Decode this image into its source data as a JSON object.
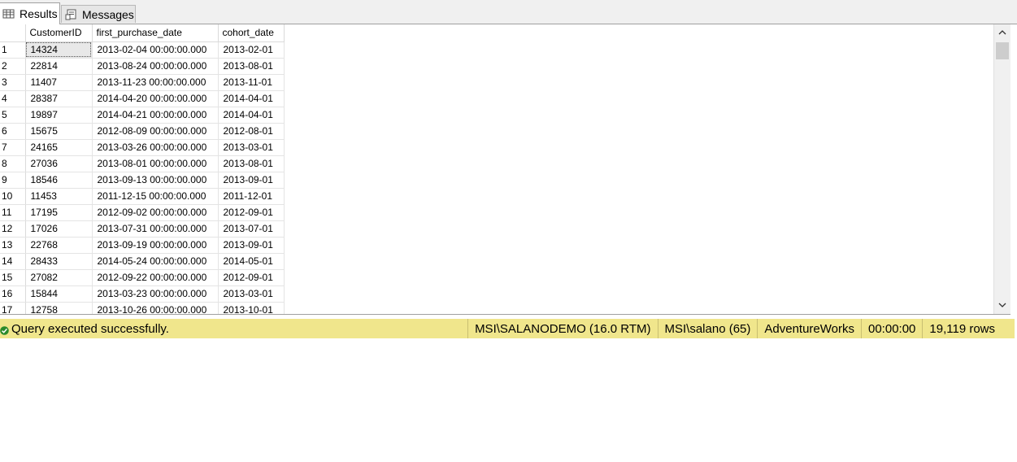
{
  "tabs": {
    "results_label": "Results",
    "messages_label": "Messages"
  },
  "grid": {
    "columns": [
      "CustomerID",
      "first_purchase_date",
      "cohort_date"
    ],
    "rows": [
      {
        "n": "1",
        "id": "14324",
        "first": "2013-02-04 00:00:00.000",
        "cohort": "2013-02-01"
      },
      {
        "n": "2",
        "id": "22814",
        "first": "2013-08-24 00:00:00.000",
        "cohort": "2013-08-01"
      },
      {
        "n": "3",
        "id": "11407",
        "first": "2013-11-23 00:00:00.000",
        "cohort": "2013-11-01"
      },
      {
        "n": "4",
        "id": "28387",
        "first": "2014-04-20 00:00:00.000",
        "cohort": "2014-04-01"
      },
      {
        "n": "5",
        "id": "19897",
        "first": "2014-04-21 00:00:00.000",
        "cohort": "2014-04-01"
      },
      {
        "n": "6",
        "id": "15675",
        "first": "2012-08-09 00:00:00.000",
        "cohort": "2012-08-01"
      },
      {
        "n": "7",
        "id": "24165",
        "first": "2013-03-26 00:00:00.000",
        "cohort": "2013-03-01"
      },
      {
        "n": "8",
        "id": "27036",
        "first": "2013-08-01 00:00:00.000",
        "cohort": "2013-08-01"
      },
      {
        "n": "9",
        "id": "18546",
        "first": "2013-09-13 00:00:00.000",
        "cohort": "2013-09-01"
      },
      {
        "n": "10",
        "id": "11453",
        "first": "2011-12-15 00:00:00.000",
        "cohort": "2011-12-01"
      },
      {
        "n": "11",
        "id": "17195",
        "first": "2012-09-02 00:00:00.000",
        "cohort": "2012-09-01"
      },
      {
        "n": "12",
        "id": "17026",
        "first": "2013-07-31 00:00:00.000",
        "cohort": "2013-07-01"
      },
      {
        "n": "13",
        "id": "22768",
        "first": "2013-09-19 00:00:00.000",
        "cohort": "2013-09-01"
      },
      {
        "n": "14",
        "id": "28433",
        "first": "2014-05-24 00:00:00.000",
        "cohort": "2014-05-01"
      },
      {
        "n": "15",
        "id": "27082",
        "first": "2012-09-22 00:00:00.000",
        "cohort": "2012-09-01"
      },
      {
        "n": "16",
        "id": "15844",
        "first": "2013-03-23 00:00:00.000",
        "cohort": "2013-03-01"
      },
      {
        "n": "17",
        "id": "12758",
        "first": "2013-10-26 00:00:00.000",
        "cohort": "2013-10-01"
      }
    ]
  },
  "status": {
    "message": "Query executed successfully.",
    "server": "MSI\\SALANODEMO (16.0 RTM)",
    "user": "MSI\\salano (65)",
    "database": "AdventureWorks",
    "elapsed": "00:00:00",
    "row_count": "19,119 rows",
    "bar_color": "#f0e68c",
    "ok_icon": "success-check-icon"
  }
}
